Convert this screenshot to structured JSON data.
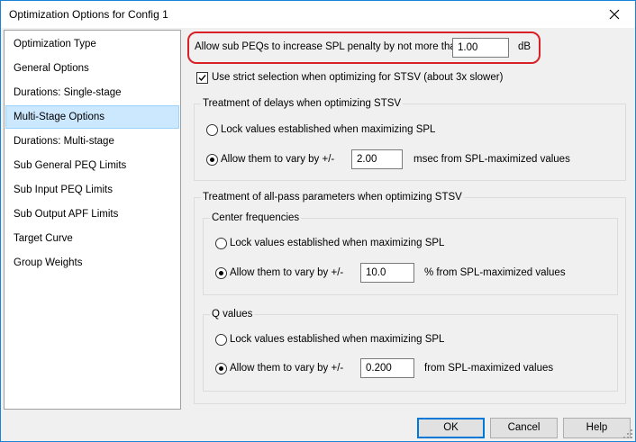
{
  "window": {
    "title": "Optimization Options for Config 1"
  },
  "sidebar": {
    "items": [
      {
        "label": "Optimization Type"
      },
      {
        "label": "General Options"
      },
      {
        "label": "Durations: Single-stage"
      },
      {
        "label": "Multi-Stage Options",
        "selected": true
      },
      {
        "label": "Durations: Multi-stage"
      },
      {
        "label": "Sub General PEQ Limits"
      },
      {
        "label": "Sub Input PEQ Limits"
      },
      {
        "label": "Sub Output APF Limits"
      },
      {
        "label": "Target Curve"
      },
      {
        "label": "Group Weights"
      }
    ]
  },
  "main": {
    "spl_penalty_label": "Allow sub PEQs to increase SPL penalty by not more than",
    "spl_penalty_value": "1.00",
    "spl_penalty_unit": "dB",
    "strict_selection_label": "Use strict selection when optimizing for STSV (about 3x slower)",
    "strict_selection_checked": true,
    "delays": {
      "title": "Treatment of delays when optimizing STSV",
      "lock_label": "Lock values established when maximizing SPL",
      "vary_label": "Allow them to vary by +/-",
      "vary_value": "2.00",
      "vary_suffix": "msec from SPL-maximized values"
    },
    "allpass": {
      "title": "Treatment of all-pass parameters when optimizing STSV",
      "center": {
        "title": "Center frequencies",
        "lock_label": "Lock values established when maximizing SPL",
        "vary_label": "Allow them to vary by +/-",
        "vary_value": "10.0",
        "vary_suffix": "% from SPL-maximized values"
      },
      "q": {
        "title": "Q values",
        "lock_label": "Lock values established when maximizing SPL",
        "vary_label": "Allow them to vary by +/-",
        "vary_value": "0.200",
        "vary_suffix": "from SPL-maximized values"
      }
    }
  },
  "footer": {
    "ok_label": "OK",
    "cancel_label": "Cancel",
    "help_label": "Help"
  },
  "icons": {
    "close": "close-icon",
    "check": "checkmark-icon",
    "grip": "resize-grip-icon"
  },
  "colors": {
    "accent": "#0078d7",
    "selection": "#cce8ff",
    "highlight_ring": "#d92027"
  }
}
